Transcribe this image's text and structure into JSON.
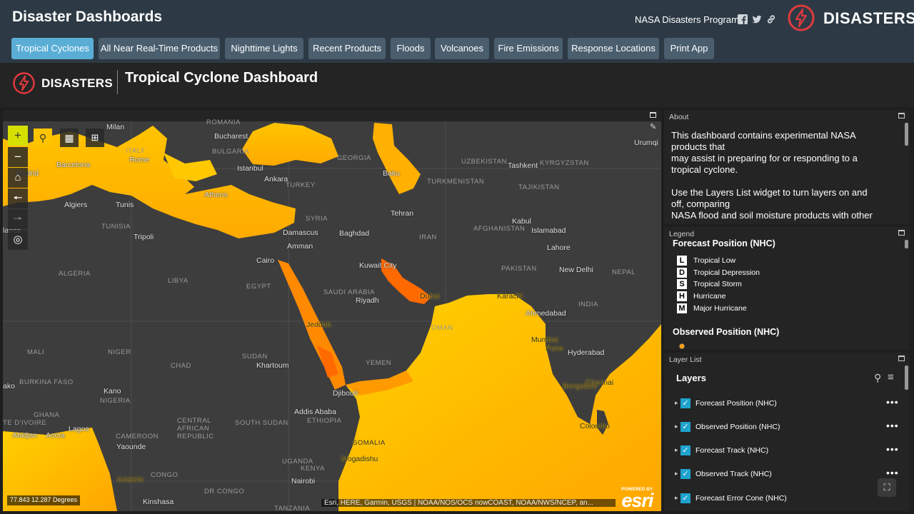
{
  "app": {
    "title": "Disaster Dashboards",
    "program": "NASA Disasters Program",
    "brand": "DISASTERS"
  },
  "tabs": [
    {
      "label": "Tropical Cyclones",
      "active": true
    },
    {
      "label": "All Near Real-Time Products"
    },
    {
      "label": "Nighttime Lights"
    },
    {
      "label": "Recent Products"
    },
    {
      "label": "Floods"
    },
    {
      "label": "Volcanoes"
    },
    {
      "label": "Fire Emissions"
    },
    {
      "label": "Response Locations"
    },
    {
      "label": "Print App"
    }
  ],
  "dashboard": {
    "brand": "DISASTERS",
    "title": "Tropical Cyclone Dashboard"
  },
  "map": {
    "coords": "77.843 12.287 Degrees",
    "attribution": "Esri, HERE, Garmin, USGS | NOAA/NOS/OCS nowCOAST, NOAA/NWS/NCEP, an...",
    "powered_by": "POWERED BY",
    "esri": "esri",
    "labels": {
      "milan": "Milan",
      "romania": "ROMANIA",
      "bucharest": "Bucharest",
      "bulgaria": "BULGARIA",
      "italy": "ITALY",
      "rome": "Rome",
      "barcelona": "Barcelona",
      "madrid": "Madrid",
      "istanbul": "Istanbul",
      "ankara": "Ankara",
      "turkey": "TURKEY",
      "athens": "Athens",
      "georgia": "GEORGIA",
      "baku": "Baku",
      "uzbekistan": "UZBEKISTAN",
      "tashkent": "Tashkent",
      "kyrgyzstan": "KYRGYZSTAN",
      "turkmenistan": "TURKMENISTAN",
      "tajikistan": "TAJIKISTAN",
      "urumqi": "Urumqi",
      "algiers": "Algiers",
      "tunis": "Tunis",
      "tunisia": "TUNISIA",
      "tripoli": "Tripoli",
      "syria": "SYRIA",
      "damascus": "Damascus",
      "baghdad": "Baghdad",
      "tehran": "Tehran",
      "iran": "IRAN",
      "afghanistan": "AFGHANISTAN",
      "kabul": "Kabul",
      "islamabad": "Islamabad",
      "lahore": "Lahore",
      "amman": "Amman",
      "cairo": "Cairo",
      "kuwait": "Kuwait City",
      "pakistan": "PAKISTAN",
      "new_delhi": "New Delhi",
      "nepal": "NEPAL",
      "algeria": "ALGERIA",
      "libya": "LIBYA",
      "egypt": "EGYPT",
      "saudi": "SAUDI ARABIA",
      "riyadh": "Riyadh",
      "dubai": "Dubai",
      "karachi": "Karachi",
      "india": "INDIA",
      "ahmedabad": "Ahmedabad",
      "jeddah": "Jeddah",
      "oman": "OMAN",
      "mali": "MALI",
      "niger": "NIGER",
      "chad": "CHAD",
      "sudan": "SUDAN",
      "khartoum": "Khartoum",
      "yemen": "YEMEN",
      "mumbai": "Mumbai",
      "pune": "Pune",
      "hyderabad": "Hyderabad",
      "faso": "BURKINA FASO",
      "kano": "Kano",
      "nigeria": "NIGERIA",
      "djibouti": "Djibouti",
      "bengaluru": "Bengaluru",
      "chennai": "Chennai",
      "ghana": "GHANA",
      "central": "CENTRAL",
      "african": "AFRICAN",
      "republic": "REPUBLIC",
      "south_sudan": "SOUTH SUDAN",
      "addis": "Addis Ababa",
      "ethiopia": "ETHIOPIA",
      "colombo": "Colombo",
      "ivoire": "TE D'IVOIRE",
      "abidjan": "Abidjan",
      "accra": "Accra",
      "lagos": "Lagos",
      "cameroon": "CAMEROON",
      "yaounde": "Yaounde",
      "somalia": "SOMALIA",
      "uganda": "UGANDA",
      "kenya": "KENYA",
      "mogadishu": "Mogadishu",
      "nairobi": "Nairobi",
      "congo": "CONGO",
      "gabon": "GABON",
      "dr_congo": "DR CONGO",
      "kinshasa": "Kinshasa",
      "tanzania": "TANZANIA",
      "ako": "ako",
      "lanca": "lanca"
    }
  },
  "about": {
    "title": "About",
    "p1a": "This dashboard contains experimental NASA products that",
    "p1b": "may assist in preparing for or responding to a tropical cyclone.",
    "p2a": "Use the Layers List widget to turn layers on and off, comparing",
    "p2b": "NASA flood and soil moisture products with other"
  },
  "legend": {
    "title": "Legend",
    "forecast_heading": "Forecast Position (NHC)",
    "items": [
      {
        "symbol": "L",
        "label": "Tropical Low"
      },
      {
        "symbol": "D",
        "label": "Tropical Depression"
      },
      {
        "symbol": "S",
        "label": "Tropical Storm"
      },
      {
        "symbol": "H",
        "label": "Hurricane"
      },
      {
        "symbol": "M",
        "label": "Major Hurricane"
      }
    ],
    "observed_heading": "Observed Position (NHC)"
  },
  "layer_list": {
    "title": "Layer List",
    "heading": "Layers",
    "layers": [
      {
        "label": "Forecast Position (NHC)",
        "checked": true
      },
      {
        "label": "Observed Position (NHC)",
        "checked": true
      },
      {
        "label": "Forecast Track (NHC)",
        "checked": true
      },
      {
        "label": "Observed Track (NHC)",
        "checked": true
      },
      {
        "label": "Forecast Error Cone (NHC)",
        "checked": true
      }
    ]
  },
  "colors": {
    "header_bg": "#2d3a45",
    "tab_bg": "#4a5e6e",
    "tab_active": "#5aaed6",
    "checkbox": "#1fa3cf",
    "brand_red": "#e0393e",
    "map_land": "#3d3d3d",
    "sst_warm": "#ffb300",
    "sst_hot": "#ff6a00"
  }
}
